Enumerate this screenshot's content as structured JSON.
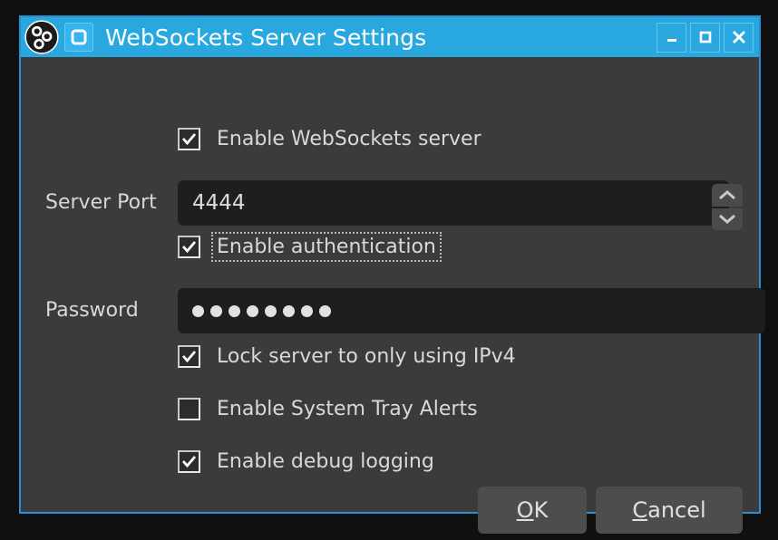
{
  "window": {
    "title": "WebSockets Server Settings",
    "app_icon": "obs-logo-icon",
    "dialog_icon": "websocket-window-icon",
    "accent_color": "#29a8e0",
    "background_color": "#3b3b3b",
    "desktop_color": "#101010",
    "buttons": {
      "minimize_label": "Minimize",
      "maximize_label": "Maximize",
      "close_label": "Close"
    }
  },
  "form": {
    "enable_server": {
      "label": "Enable WebSockets server",
      "checked": true
    },
    "server_port": {
      "label": "Server Port",
      "value": "4444",
      "spinner_up": "increment",
      "spinner_down": "decrement"
    },
    "enable_auth": {
      "label": "Enable authentication",
      "checked": true,
      "focused": true
    },
    "password": {
      "label": "Password",
      "value": "●●●●●●●●",
      "masked_char_count": 8
    },
    "lock_ipv4": {
      "label": "Lock server to only using IPv4",
      "checked": true
    },
    "tray_alerts": {
      "label": "Enable System Tray Alerts",
      "checked": false
    },
    "debug_logging": {
      "label": "Enable debug logging",
      "checked": true
    }
  },
  "actions": {
    "ok": {
      "label": "OK",
      "mnemonic": "O",
      "rest": "K"
    },
    "cancel": {
      "label": "Cancel",
      "mnemonic": "C",
      "rest": "ancel"
    }
  }
}
